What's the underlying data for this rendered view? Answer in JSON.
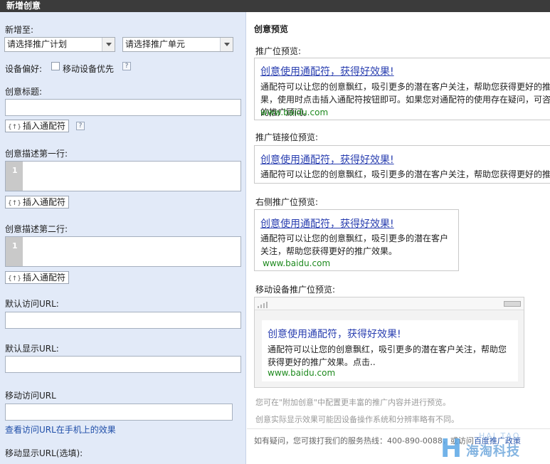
{
  "window": {
    "title": "新增创意"
  },
  "form": {
    "add_to_label": "新增至:",
    "plan_select": "请选择推广计划",
    "unit_select": "请选择推广单元",
    "device_pref_label": "设备偏好:",
    "mobile_priority_label": "移动设备优先",
    "help_mark": "?",
    "title_label": "创意标题:",
    "insert_wildcard": "插入通配符",
    "insert_tag": "{↑}",
    "desc1_label": "创意描述第一行:",
    "desc2_label": "创意描述第二行:",
    "line_number": "1",
    "default_visit_url_label": "默认访问URL:",
    "default_display_url_label": "默认显示URL:",
    "mobile_visit_url_label": "移动访问URL",
    "view_mobile_link": "查看访问URL在手机上的效果",
    "mobile_display_url_label": "移动显示URL(选填):"
  },
  "preview": {
    "heading": "创意预览",
    "promo_label": "推广位预览:",
    "promo_link_label": "推广链接位预览:",
    "right_label": "右侧推广位预览:",
    "mobile_label": "移动设备推广位预览:",
    "ad_title": "创意使用通配符，获得好效果!",
    "promo_desc": "通配符可以让您的创意飘红，吸引更多的潜在客户关注，帮助您获得更好的推广效果，使用时点击插入通配符按钮即可。如果您对通配符的使用存在疑问，可咨询您的推广顾问。",
    "right_desc": "通配符可以让您的创意飘红，吸引更多的潜在客户关注，帮助您获得更好的推广效果。",
    "mobile_desc": "通配符可以让您的创意飘红，吸引更多的潜在客户关注，帮助您获得更好的推广效果。点击..",
    "url": "www.baidu.com",
    "note1": "您可在\"附加创意\"中配置更丰富的推广内容并进行预览。",
    "note2": "创意实际显示效果可能因设备操作系统和分辨率略有不同。",
    "footer_text": "如有疑问，您可拨打我们的服务热线：400-890-0088，或访问",
    "footer_link": "百度推广政策"
  },
  "watermark": {
    "letter": "H",
    "name": "海淘科技",
    "latin": "HAI TAO"
  }
}
